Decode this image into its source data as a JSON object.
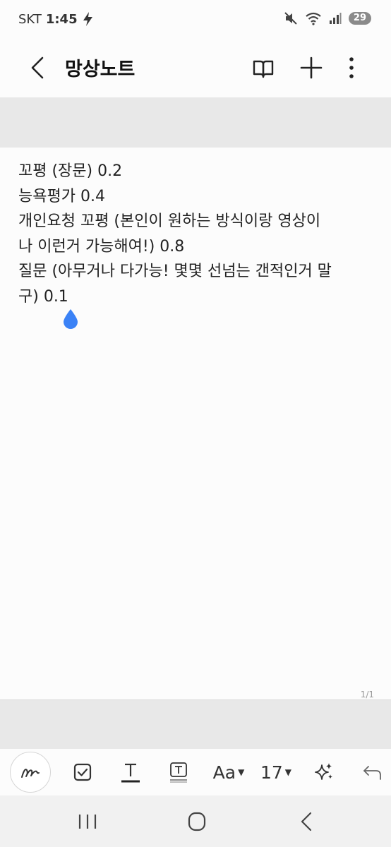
{
  "status_bar": {
    "carrier": "SKT",
    "time": "1:45",
    "battery": "29"
  },
  "app_bar": {
    "title": "망상노트"
  },
  "note": {
    "lines": [
      "꼬평 (장문) 0.2",
      "능욕평가 0.4",
      "개인요청 꼬평 (본인이 원하는 방식이랑 영상이",
      "나 이런거 가능해여!) 0.8",
      "질문 (아무거나 다가능! 몇몇 선넘는 갠적인거 말",
      "구) 0.1"
    ],
    "page_indicator": "1/1"
  },
  "toolbar": {
    "font_style_label": "Aa",
    "font_size": "17"
  },
  "colors": {
    "accent": "#3b82f6",
    "band_gray": "#e8e8e8"
  }
}
